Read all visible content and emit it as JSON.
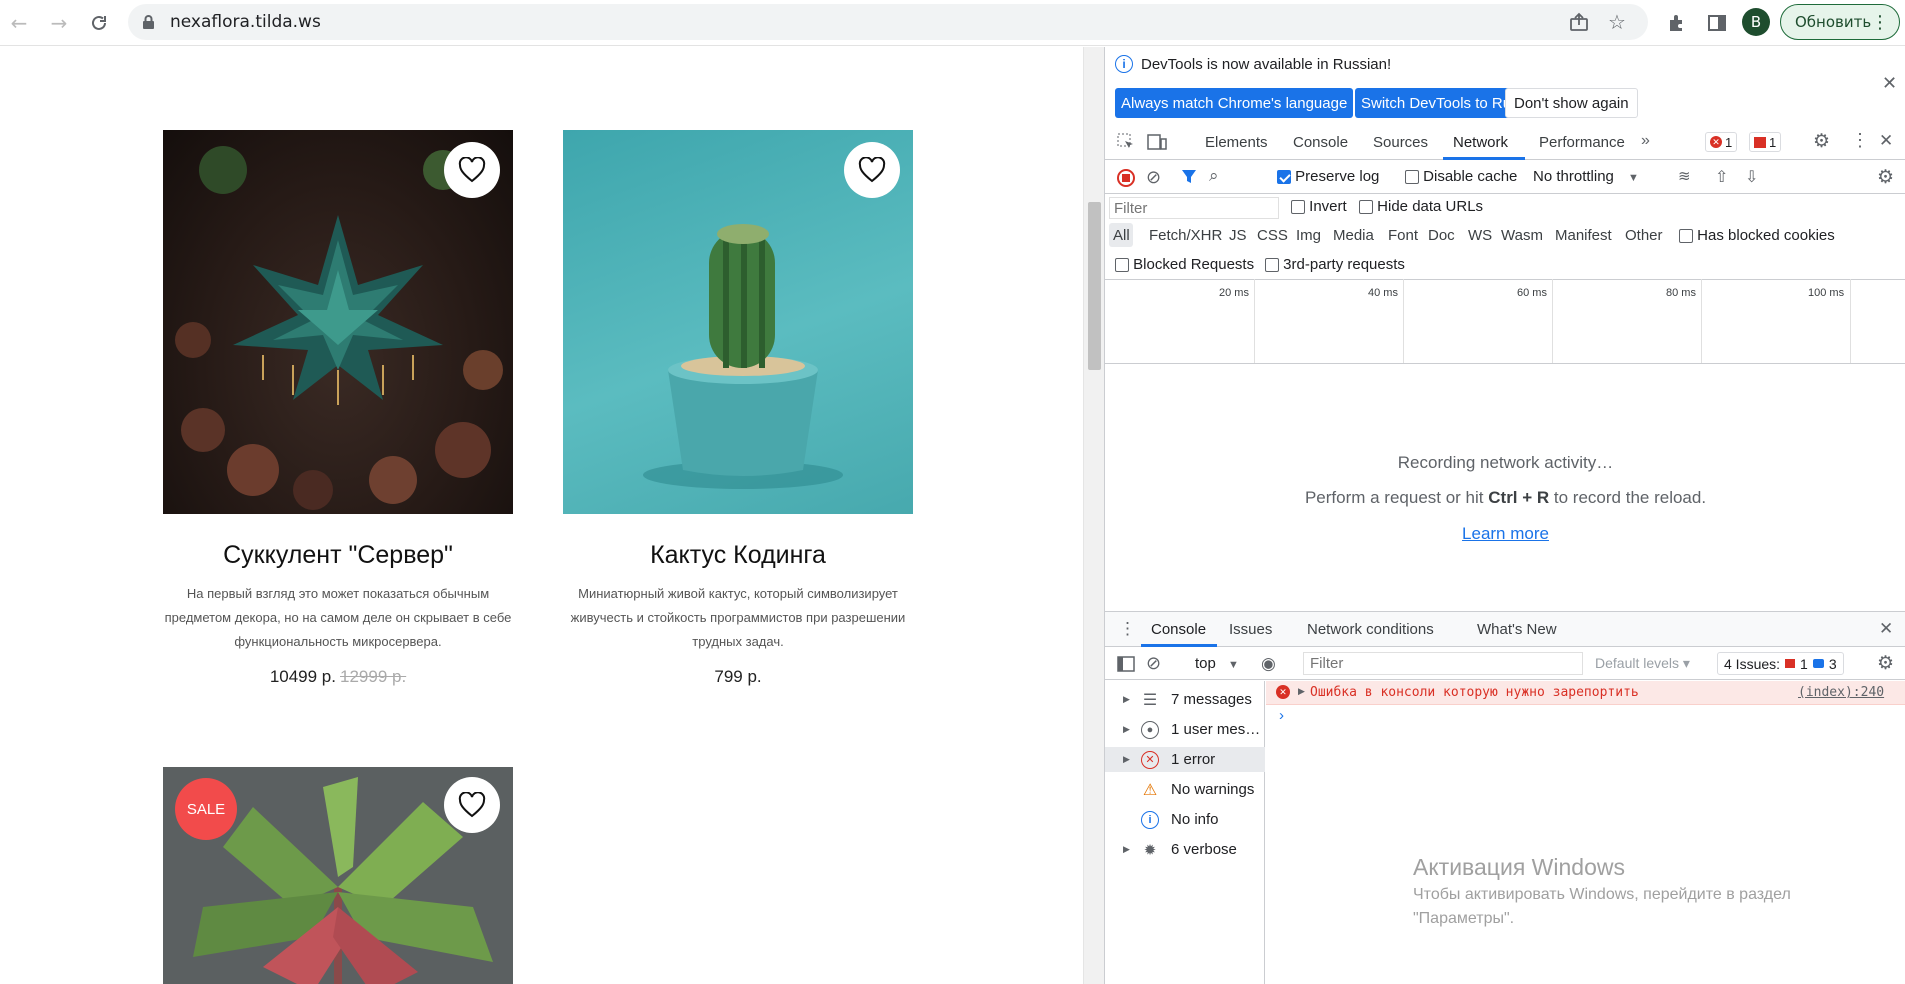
{
  "browser": {
    "url": "nexaflora.tilda.ws",
    "avatar_letter": "B",
    "update_label": "Обновить"
  },
  "products": [
    {
      "title": "Суккулент \"Сервер\"",
      "description": "На первый взгляд это может показаться обычным предметом декора, но на самом деле он скрывает в себе функциональность микросервера.",
      "price": "10499 р.",
      "old_price": "12999 р."
    },
    {
      "title": "Кактус Кодинга",
      "description": "Миниатюрный живой кактус, который символизирует живучесть и стойкость программистов при разрешении трудных задач.",
      "price": "799 р."
    },
    {
      "sale_badge": "SALE"
    }
  ],
  "devtools": {
    "banner_text": "DevTools is now available in Russian!",
    "btn_match": "Always match Chrome's language",
    "btn_switch": "Switch DevTools to Russian",
    "btn_dont_show": "Don't show again",
    "tabs": [
      "Elements",
      "Console",
      "Sources",
      "Network",
      "Performance"
    ],
    "active_tab": "Network",
    "error_count": "1",
    "issue_count": "1",
    "preserve_log": "Preserve log",
    "disable_cache": "Disable cache",
    "throttling": "No throttling",
    "filter_placeholder": "Filter",
    "invert": "Invert",
    "hide_data_urls": "Hide data URLs",
    "filter_types": [
      "All",
      "Fetch/XHR",
      "JS",
      "CSS",
      "Img",
      "Media",
      "Font",
      "Doc",
      "WS",
      "Wasm",
      "Manifest",
      "Other"
    ],
    "has_blocked_cookies": "Has blocked cookies",
    "blocked_requests": "Blocked Requests",
    "third_party": "3rd-party requests",
    "ticks": [
      "20 ms",
      "40 ms",
      "60 ms",
      "80 ms",
      "100 ms"
    ],
    "recording": "Recording network activity…",
    "perform_pre": "Perform a request or hit ",
    "perform_keys": "Ctrl + R",
    "perform_post": " to record the reload.",
    "learn_more": "Learn more",
    "drawer_tabs": [
      "Console",
      "Issues",
      "Network conditions",
      "What's New"
    ],
    "context": "top",
    "console_filter": "Filter",
    "levels": "Default levels",
    "issues_label": "4 Issues:",
    "issues_err": "1",
    "issues_info": "3",
    "sidebar": [
      {
        "label": "7 messages",
        "icon": "list-icon"
      },
      {
        "label": "1 user mes…",
        "icon": "user-icon"
      },
      {
        "label": "1 error",
        "icon": "error-icon"
      },
      {
        "label": "No warnings",
        "icon": "warning-icon"
      },
      {
        "label": "No info",
        "icon": "info-icon"
      },
      {
        "label": "6 verbose",
        "icon": "bug-icon"
      }
    ],
    "console_error": "Ошибка в консоли которую нужно зарепортить",
    "console_source": "(index):240",
    "watermark_title": "Активация Windows",
    "watermark_line1": "Чтобы активировать Windows, перейдите в раздел",
    "watermark_line2": "\"Параметры\"."
  }
}
